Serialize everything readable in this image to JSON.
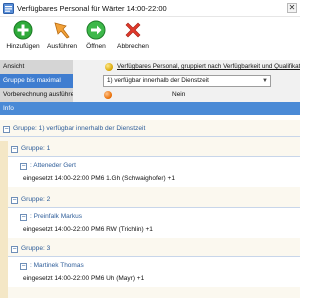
{
  "window": {
    "title": "Verfügbares Personal für Wärter 14:00-22:00",
    "close_glyph": "✕"
  },
  "toolbar": {
    "items": [
      {
        "label": "Hinzufügen",
        "icon": "add-icon"
      },
      {
        "label": "Ausführen",
        "icon": "execute-icon"
      },
      {
        "label": "Öffnen",
        "icon": "open-icon"
      },
      {
        "label": "Abbrechen",
        "icon": "cancel-icon"
      }
    ]
  },
  "properties": {
    "ansicht": {
      "label": "Ansicht",
      "value": "Verfügbares Personal, gruppiert nach Verfügbarkeit und Qualifikationsstufe"
    },
    "gruppe_bis_maximal": {
      "label": "Gruppe bis maximal",
      "value": "1) verfügbar innerhalb der Dienstzeit"
    },
    "vorberechnung": {
      "label": "Vorberechnung ausführen",
      "value": "Nein"
    },
    "info_label": "Info"
  },
  "tree": {
    "top_group": "Gruppe: 1) verfügbar innerhalb der Dienstzeit",
    "groups": [
      {
        "title": "Gruppe: 1",
        "person": ": Atteneder Gert",
        "detail": "eingesetzt 14:00-22:00 PM6 1.Gh (Schwaighofer) +1"
      },
      {
        "title": "Gruppe: 2",
        "person": ": Preinfalk Markus",
        "detail": "eingesetzt 14:00-22:00 PM6 RW (Trichlin) +1"
      },
      {
        "title": "Gruppe: 3",
        "person": ": Martinek Thomas",
        "detail": "eingesetzt 14:00-22:00 PM6 Uh (Mayr) +1"
      }
    ]
  },
  "colors": {
    "selection_blue": "#3f7dd0",
    "info_blue": "#4a8ad6",
    "group_text": "#2f5e9a",
    "tree_background": "#fbf8ef"
  }
}
